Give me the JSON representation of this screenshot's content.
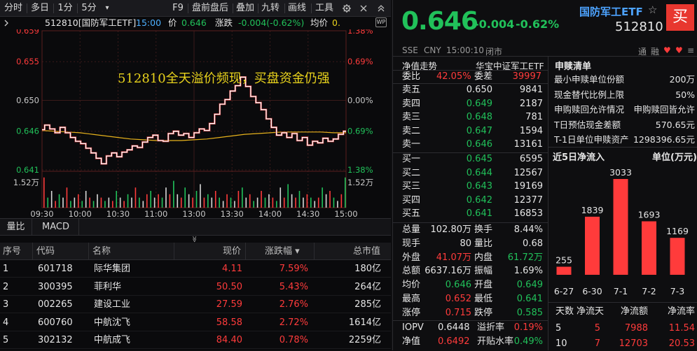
{
  "toolbar": {
    "timeshare": "分时",
    "multi_day": "多日",
    "m1": "1分",
    "m5": "5分",
    "dropdown": "▾",
    "f9": "F9",
    "pre_after": "盘前盘后",
    "overlay": "叠加",
    "nine_turn": "九转",
    "draw": "画线",
    "tools": "工具"
  },
  "info": {
    "code_name": "512810[国防军工ETF]",
    "time": "15:00",
    "price_label": "价",
    "price": "0.646",
    "change_label": "涨跌",
    "change": "-0.004(-0.62%)",
    "avg_label": "均价",
    "avg": "0."
  },
  "chart": {
    "annotation": "512810全天溢价频现，买盘资金仍强",
    "prices": [
      "0.659",
      "0.655",
      "0.650",
      "0.646",
      "0.641"
    ],
    "pcts": [
      "1.38%",
      "0.69%",
      "0.00%",
      "0.69%",
      "1.38%"
    ],
    "vol_label": "1.52万",
    "times": [
      "09:30",
      "10:00",
      "10:30",
      "11:00",
      "13:00",
      "13:30",
      "14:00",
      "14:30",
      "15:00"
    ],
    "price_series": [
      0.6462,
      0.6468,
      0.6463,
      0.6458,
      0.6465,
      0.6458,
      0.6452,
      0.6447,
      0.6444,
      0.6438,
      0.6432,
      0.6425,
      0.6418,
      0.6428,
      0.6432,
      0.6427,
      0.6433,
      0.6436,
      0.6441,
      0.6439,
      0.6446,
      0.6452,
      0.6455,
      0.6448,
      0.6447,
      0.6457,
      0.646,
      0.6455,
      0.6457,
      0.6452,
      0.6458,
      0.6463,
      0.6461,
      0.647,
      0.6482,
      0.6495,
      0.6501,
      0.6512,
      0.6519,
      0.653,
      0.6518,
      0.6505,
      0.6497,
      0.6488,
      0.6476,
      0.6465,
      0.6455,
      0.6458,
      0.6452,
      0.6457,
      0.6448,
      0.6452,
      0.6442,
      0.6447,
      0.6445,
      0.6451,
      0.6447,
      0.645,
      0.6456,
      0.646
    ],
    "avg_series": [
      0.6461,
      0.646,
      0.6459,
      0.6458,
      0.6456,
      0.6454,
      0.6452,
      0.645,
      0.6449,
      0.6448,
      0.6448,
      0.6448,
      0.6449,
      0.645,
      0.6452,
      0.6454,
      0.6456,
      0.6457,
      0.6458,
      0.6459,
      0.6459,
      0.6459,
      0.6459,
      0.6458,
      0.6458
    ],
    "volumes": [
      0.9,
      0.3,
      0.5,
      0.2,
      0.4,
      0.3,
      0.6,
      0.2,
      0.3,
      0.4,
      0.2,
      0.5,
      0.3,
      0.2,
      0.4,
      0.3,
      0.2,
      0.3,
      0.2,
      0.5,
      0.3,
      0.2,
      0.4,
      0.3,
      0.6,
      0.3,
      0.2,
      0.4,
      0.5,
      0.3,
      0.4,
      0.3,
      0.6,
      0.4,
      0.8,
      0.4,
      0.3,
      0.6,
      0.4,
      0.3,
      0.5,
      0.7,
      0.3,
      0.4,
      0.3,
      0.5,
      0.3,
      0.2,
      0.4,
      0.3,
      0.2,
      0.5,
      0.6,
      0.3,
      0.4,
      0.2,
      0.3,
      0.5,
      0.3,
      0.4,
      0.3,
      0.2,
      0.6,
      0.3,
      0.7,
      0.4,
      0.3,
      0.5,
      0.3,
      0.4,
      0.3,
      0.2,
      0.3,
      0.6,
      0.4,
      0.5,
      0.3,
      0.2,
      0.4,
      0.9
    ],
    "volume_colors": "alt"
  },
  "subtabs": {
    "t1": "量比",
    "t2": "MACD",
    "collapse": "≪"
  },
  "table": {
    "headers": [
      "序号",
      "代码",
      "名称",
      "现价",
      "涨跌幅 ▾",
      "总市值"
    ],
    "rows": [
      [
        "1",
        "601718",
        "际华集团",
        "4.11",
        "7.59%",
        "180亿"
      ],
      [
        "2",
        "300395",
        "菲利华",
        "50.50",
        "5.43%",
        "264亿"
      ],
      [
        "3",
        "002265",
        "建设工业",
        "27.59",
        "2.76%",
        "285亿"
      ],
      [
        "4",
        "600760",
        "中航沈飞",
        "58.58",
        "2.72%",
        "1614亿"
      ],
      [
        "5",
        "302132",
        "中航成飞",
        "84.40",
        "0.78%",
        "2259亿"
      ]
    ]
  },
  "header": {
    "price": "0.646",
    "change": "-0.004",
    "pct": "-0.62%",
    "name": "国防军工ETF",
    "code": "512810",
    "buy": "买",
    "fav": "☆",
    "exchange": "SSE",
    "currency": "CNY",
    "time": "15:00:10",
    "status": "闭市",
    "tools": [
      "通",
      "融",
      "♥",
      "♥",
      "≡"
    ]
  },
  "trend": {
    "label": "净值走势",
    "fund": "华宝中证军工ETF"
  },
  "ratio": {
    "wb_label": "委比",
    "wb": "42.05%",
    "wc_label": "委差",
    "wc": "39997"
  },
  "asks": [
    {
      "l": "卖五",
      "p": "0.650",
      "v": "9841"
    },
    {
      "l": "卖四",
      "p": "0.649",
      "v": "2187"
    },
    {
      "l": "卖三",
      "p": "0.648",
      "v": "781"
    },
    {
      "l": "卖二",
      "p": "0.647",
      "v": "1594"
    },
    {
      "l": "卖一",
      "p": "0.646",
      "v": "13161"
    }
  ],
  "bids": [
    {
      "l": "买一",
      "p": "0.645",
      "v": "6595"
    },
    {
      "l": "买二",
      "p": "0.644",
      "v": "12567"
    },
    {
      "l": "买三",
      "p": "0.643",
      "v": "19169"
    },
    {
      "l": "买四",
      "p": "0.642",
      "v": "12377"
    },
    {
      "l": "买五",
      "p": "0.641",
      "v": "16853"
    }
  ],
  "stats": [
    {
      "l": "总量",
      "v": "102.80万",
      "l2": "换手",
      "v2": "8.44%"
    },
    {
      "l": "现手",
      "v": "80",
      "l2": "量比",
      "v2": "0.68"
    },
    {
      "l": "外盘",
      "v": "41.07万",
      "l2": "内盘",
      "v2": "61.72万"
    },
    {
      "l": "总额",
      "v": "6637.16万",
      "l2": "振幅",
      "v2": "1.69%"
    },
    {
      "l": "均价",
      "v": "0.646",
      "l2": "开盘",
      "v2": "0.649"
    },
    {
      "l": "最高",
      "v": "0.652",
      "l2": "最低",
      "v2": "0.641"
    },
    {
      "l": "涨停",
      "v": "0.715",
      "l2": "跌停",
      "v2": "0.585"
    }
  ],
  "iopv": {
    "l": "IOPV",
    "v": "0.6448",
    "l2": "溢折率",
    "v2": "0.19%"
  },
  "nav": {
    "l": "净值",
    "v": "0.6492",
    "l2": "开贴水率",
    "v2": "0.49%"
  },
  "subscription": {
    "title": "申赎清单",
    "rows": [
      {
        "l": "最小申赎单位份额",
        "v": "200万"
      },
      {
        "l": "现金替代比例上限",
        "v": "50%"
      },
      {
        "l": "申购赎回允许情况",
        "v": "申购赎回皆允许"
      },
      {
        "l": "T日预估现金差额",
        "v": "570.65元"
      },
      {
        "l": "T-1日单位申赎资产",
        "v": "1298396.65元"
      }
    ]
  },
  "netflow": {
    "title": "近5日净流入",
    "unit": "单位(万元)",
    "bars": [
      {
        "date": "6-27",
        "value": 255
      },
      {
        "date": "6-30",
        "value": 1839
      },
      {
        "date": "7-1",
        "value": 3033
      },
      {
        "date": "7-2",
        "value": 1693
      },
      {
        "date": "7-3",
        "value": 1169
      }
    ],
    "table_headers": [
      "天数",
      "净流天",
      "净流额",
      "净流率"
    ],
    "table_rows": [
      [
        "5",
        "5",
        "7988",
        "11.54"
      ],
      [
        "10",
        "7",
        "12703",
        "20.53"
      ]
    ]
  },
  "colors": {
    "up": "#ff3b3b",
    "down": "#21c15a",
    "line": "#ffffff",
    "avg": "#e8b21c",
    "annot": "#e8d21c"
  }
}
